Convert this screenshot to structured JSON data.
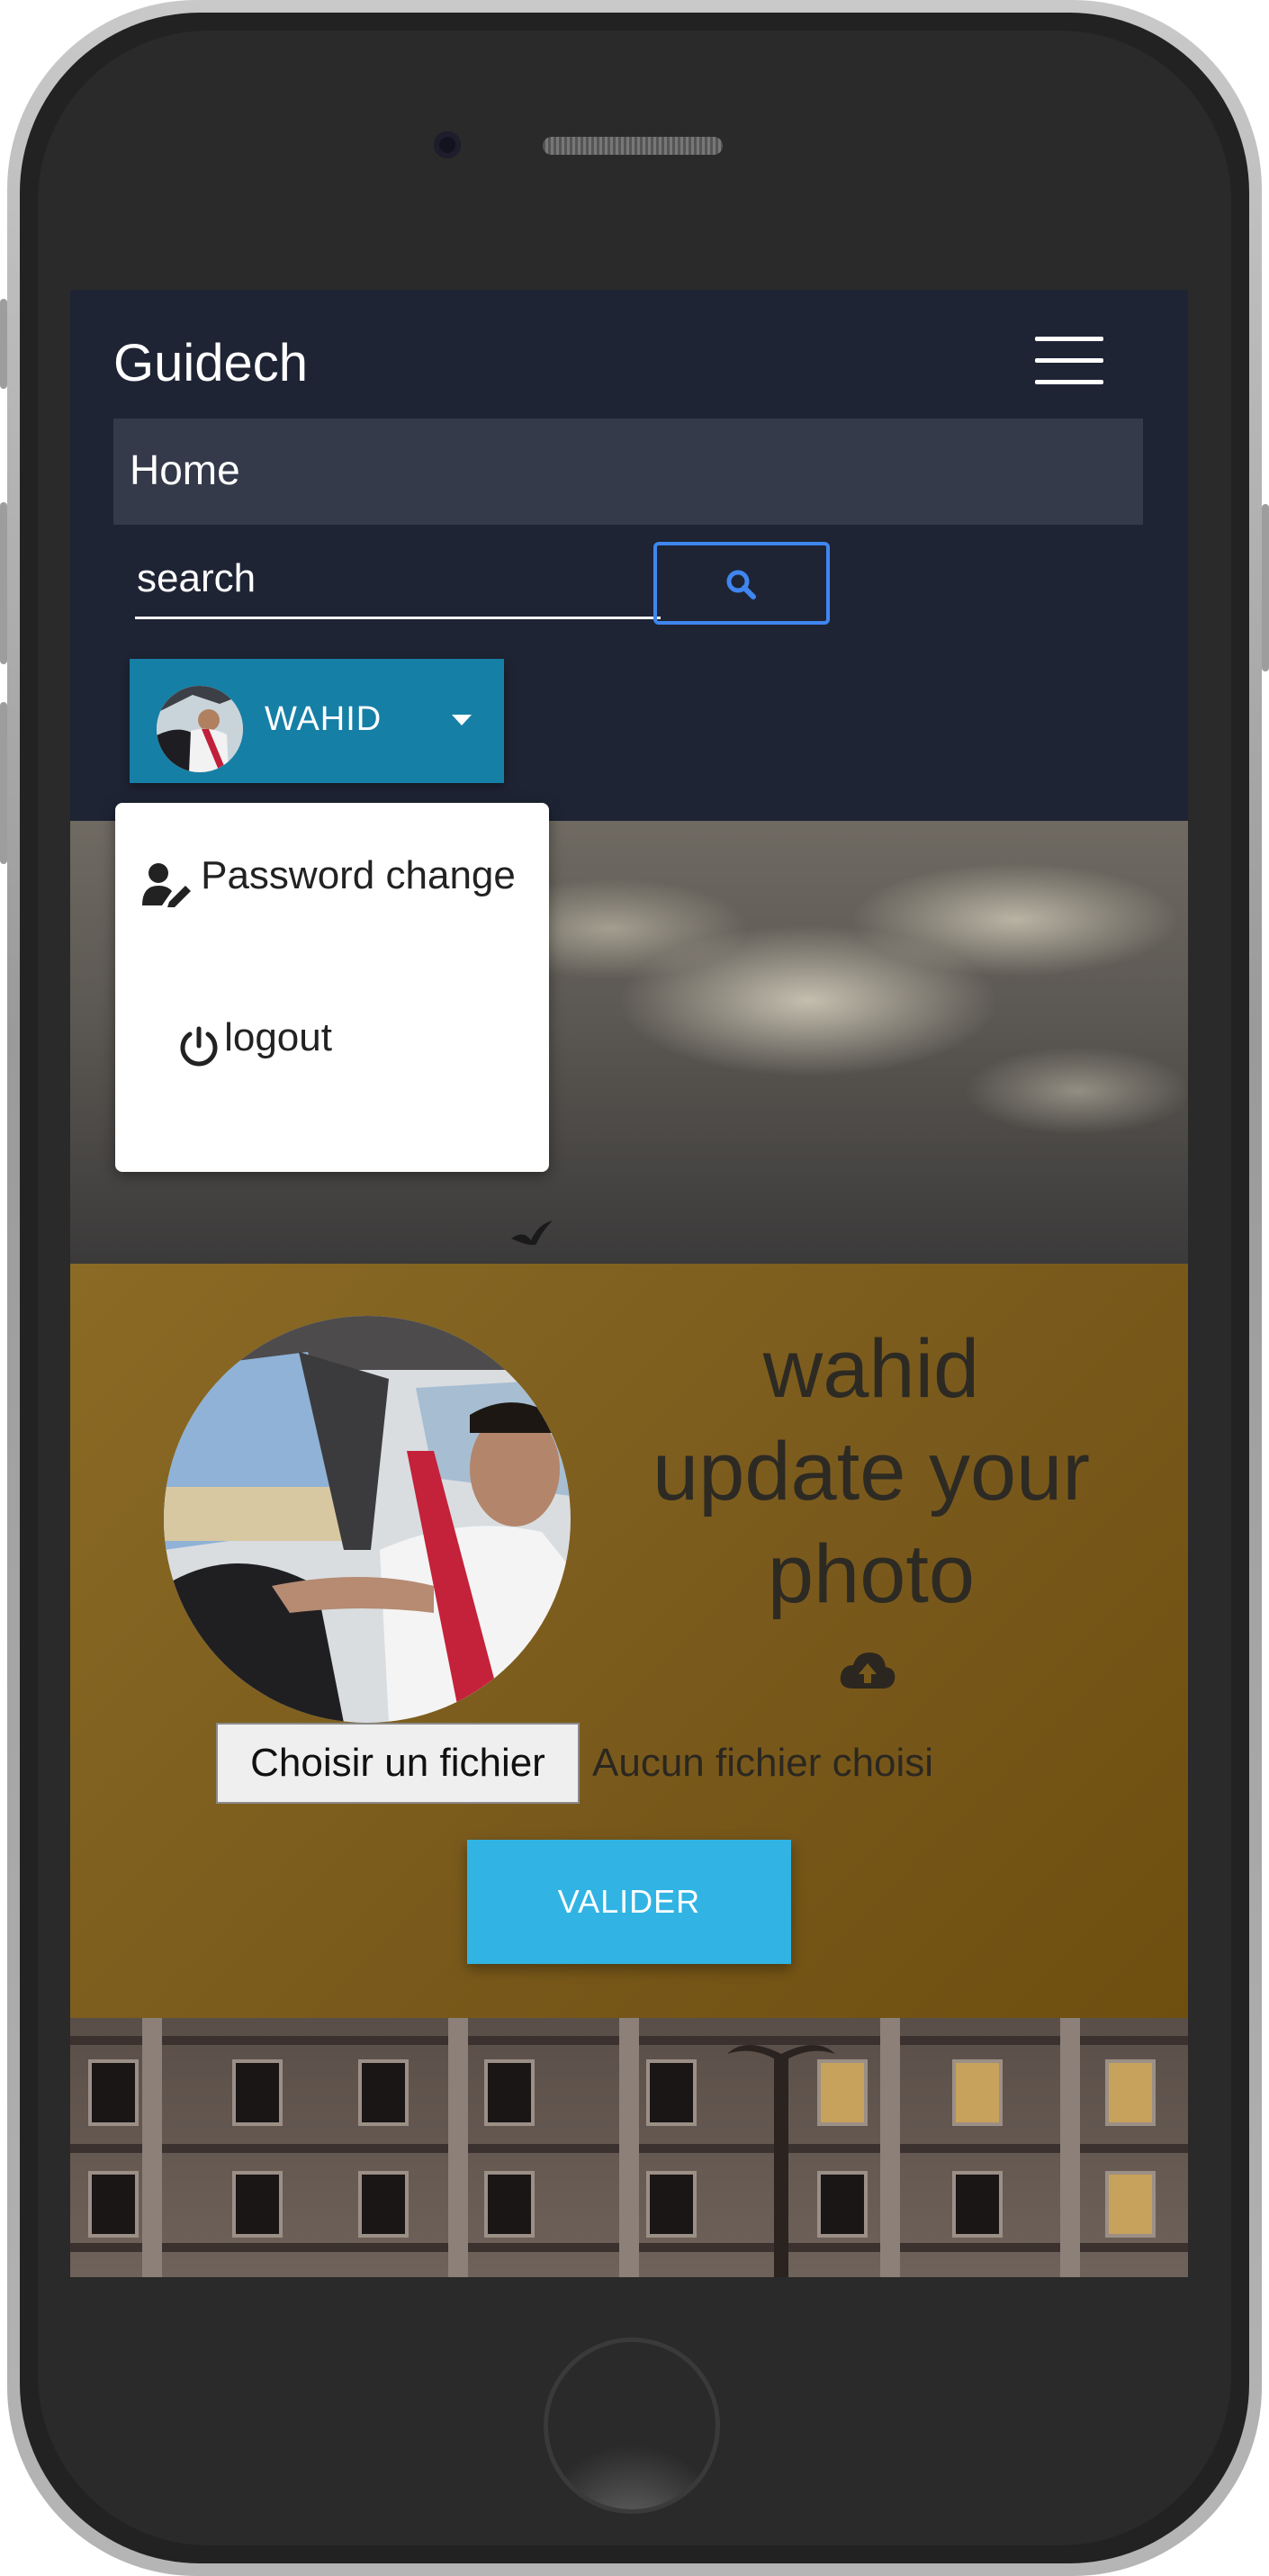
{
  "navbar": {
    "brand": "Guidech",
    "home_label": "Home",
    "search_placeholder": "search",
    "user_name": "WAHID"
  },
  "dropdown": {
    "items": [
      {
        "label": "Password change",
        "icon": "user-edit-icon"
      },
      {
        "label": "logout",
        "icon": "power-icon"
      }
    ]
  },
  "profile": {
    "title_line1": "wahid",
    "title_line2": "update your",
    "title_line3": "photo",
    "upload_icon": "cloud-upload-icon",
    "file_button_label": "Choisir un fichier",
    "file_status": "Aucun fichier choisi",
    "submit_label": "VALIDER"
  },
  "colors": {
    "navbar_bg": "#1e2434",
    "user_button_bg": "#167fa6",
    "submit_bg": "#31b4e3",
    "search_border": "#3f86f0",
    "profile_bg": "#8a6a24"
  }
}
